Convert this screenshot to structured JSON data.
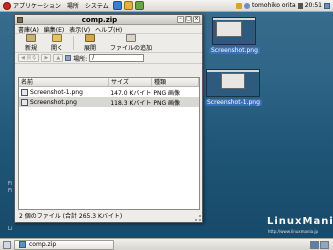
{
  "top_panel": {
    "applications": "アプリケーション",
    "places": "場所",
    "system": "システム",
    "user": "tomohiko orita",
    "clock": "20:51"
  },
  "window": {
    "title": "comp.zip",
    "menu": [
      "書庫(A)",
      "編集(E)",
      "表示(V)",
      "ヘルプ(H)"
    ],
    "toolbar": {
      "new": "新規",
      "open": "開く",
      "extract": "展開",
      "add_files": "ファイルの追加"
    },
    "nav": {
      "back": "戻る",
      "forward": "進む",
      "up": "上へ",
      "location_label": "場所:",
      "location_value": "/"
    },
    "columns": {
      "name": "名前",
      "size": "サイズ",
      "type": "種類"
    },
    "files": [
      {
        "name": "Screenshot-1.png",
        "size": "147.0 Kバイト",
        "type": "PNG 画像"
      },
      {
        "name": "Screenshot.png",
        "size": "118.3 Kバイト",
        "type": "PNG 画像"
      }
    ],
    "status": "2 個のファイル (合計 265.3 Kバイト)"
  },
  "desktop": {
    "icons": [
      "Screenshot.png",
      "Screenshot-1.png"
    ],
    "side_fragments": [
      "Fi",
      "Fi",
      "Li"
    ]
  },
  "taskbar": {
    "task": "comp.zip"
  },
  "brand": {
    "name": "LinuxMania",
    "url": "http://www.linuxmania.jp"
  }
}
